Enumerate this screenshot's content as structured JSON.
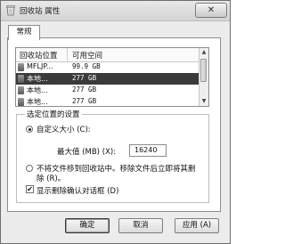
{
  "window": {
    "title": "回收站 属性",
    "close_glyph": "✕"
  },
  "tabs": [
    {
      "label": "常规"
    }
  ],
  "list": {
    "columns": [
      "回收站位置",
      "可用空间"
    ],
    "rows": [
      {
        "name": "MFLJP...",
        "capacity": "99.9 GB",
        "selected": false
      },
      {
        "name": "本地...",
        "capacity": "277 GB",
        "selected": true
      },
      {
        "name": "本地...",
        "capacity": "277 GB",
        "selected": false
      },
      {
        "name": "本地...",
        "capacity": "277 GB",
        "selected": false
      }
    ]
  },
  "settings": {
    "group_label": "选定位置的设置",
    "custom_size_label": "自定义大小 (C):",
    "max_label": "最大值 (MB) (X):",
    "max_value": "16240",
    "no_move_label_line1": "不将文件移到回收站中。移除文件后立即将其删",
    "no_move_label_line2": "除 (R)。",
    "confirm_label": "显示删除确认对话框 (D)",
    "confirm_checked": true,
    "selected_option": "custom"
  },
  "buttons": {
    "ok": "确定",
    "cancel": "取消",
    "apply": "应用 (A)"
  },
  "icons": {
    "title_icon": "recycle-bin-icon",
    "drive_icon": "hard-drive-icon",
    "scroll_up": "▲",
    "scroll_down": "▼",
    "check": "✔"
  }
}
